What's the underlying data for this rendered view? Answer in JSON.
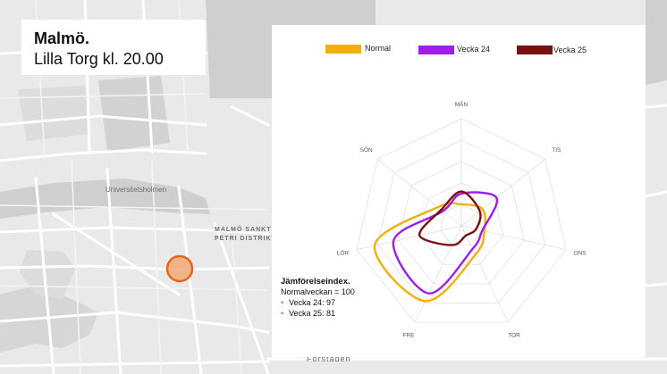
{
  "map": {
    "labels": {
      "universitetsholmen": "Universitetsholmen",
      "district_line1": "MALMÖ SANKT",
      "district_line2": "PETRI DISTRIKT",
      "forstaden": "Förstaden"
    },
    "marker_color": "#e8641e"
  },
  "header": {
    "title": "Malmö.",
    "subtitle": "Lilla Torg kl. 20.00"
  },
  "legend": [
    {
      "name": "Normal",
      "color": "#f2b10a"
    },
    {
      "name": "Vecka 24",
      "color": "#a01de8"
    },
    {
      "name": "Vecka 25",
      "color": "#7a0f0f"
    }
  ],
  "comparison": {
    "title": "Jämförelseindex.",
    "subtitle": "Normalveckan = 100",
    "items": [
      "Vecka 24: 97",
      "Vecka 25: 81"
    ]
  },
  "chart_data": {
    "type": "radar",
    "categories": [
      "MÅN",
      "TIS",
      "ONS",
      "TOR",
      "FRE",
      "LÖR",
      "SÖN"
    ],
    "rmax": 100,
    "rings": 5,
    "series": [
      {
        "name": "Normal",
        "color": "#f2b10a",
        "values": [
          20,
          25,
          22,
          30,
          78,
          83,
          28
        ]
      },
      {
        "name": "Vecka 24",
        "color": "#a01de8",
        "values": [
          30,
          42,
          20,
          24,
          70,
          65,
          22
        ]
      },
      {
        "name": "Vecka 25",
        "color": "#7a0f0f",
        "values": [
          32,
          22,
          14,
          10,
          20,
          40,
          24
        ]
      }
    ]
  }
}
